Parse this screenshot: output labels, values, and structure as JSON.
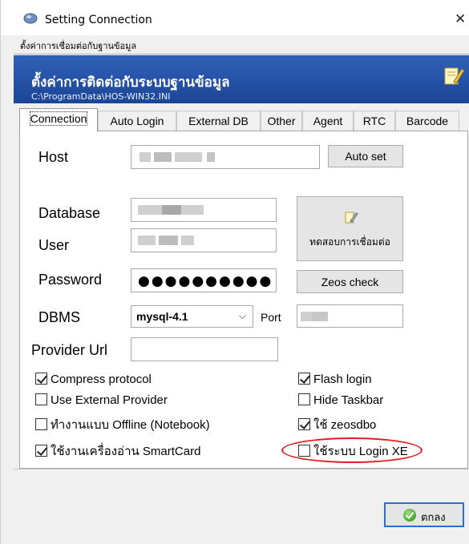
{
  "window": {
    "title": "Setting Connection",
    "close_glyph": "✕",
    "caption": "ตั้งค่าการเชื่อมต่อกับฐานข้อมูล"
  },
  "banner": {
    "title": "ตั้งค่าการติดต่อกับระบบฐานข้อมูล",
    "path": "C:\\ProgramData\\HOS-WIN32.INI",
    "icon": "edit-settings-icon"
  },
  "tabs": [
    "Connection",
    "Auto Login",
    "External DB",
    "Other",
    "Agent",
    "RTC",
    "Barcode"
  ],
  "active_tab": "Connection",
  "form": {
    "host_label": "Host",
    "database_label": "Database",
    "user_label": "User",
    "password_label": "Password",
    "password_value": "●●●●●●●●●●",
    "dbms_label": "DBMS",
    "dbms_value": "mysql-4.1",
    "port_label": "Port",
    "provider_url_label": "Provider Url",
    "provider_url_value": ""
  },
  "buttons": {
    "auto_set": "Auto set",
    "test_connection": "ทดสอบการเชื่อมต่อ",
    "zeos_check": "Zeos check",
    "ok": "ตกลง"
  },
  "checkboxes": {
    "compress_protocol": {
      "label": "Compress protocol",
      "checked": true
    },
    "use_external_provider": {
      "label": "Use External Provider",
      "checked": false
    },
    "offline_notebook": {
      "label": "ทำงานแบบ Offline (Notebook)",
      "checked": false
    },
    "smartcard": {
      "label": "ใช้งานเครื่องอ่าน SmartCard",
      "checked": true
    },
    "flash_login": {
      "label": "Flash login",
      "checked": true
    },
    "hide_taskbar": {
      "label": "Hide Taskbar",
      "checked": false
    },
    "use_zeosdbo": {
      "label": "ใช้ zeosdbo",
      "checked": true
    },
    "login_xe": {
      "label": "ใช้ระบบ Login XE",
      "checked": false
    }
  },
  "colors": {
    "banner": "#2f61b7",
    "highlight": "#e02020",
    "ok_focus": "#2b6fd0"
  }
}
